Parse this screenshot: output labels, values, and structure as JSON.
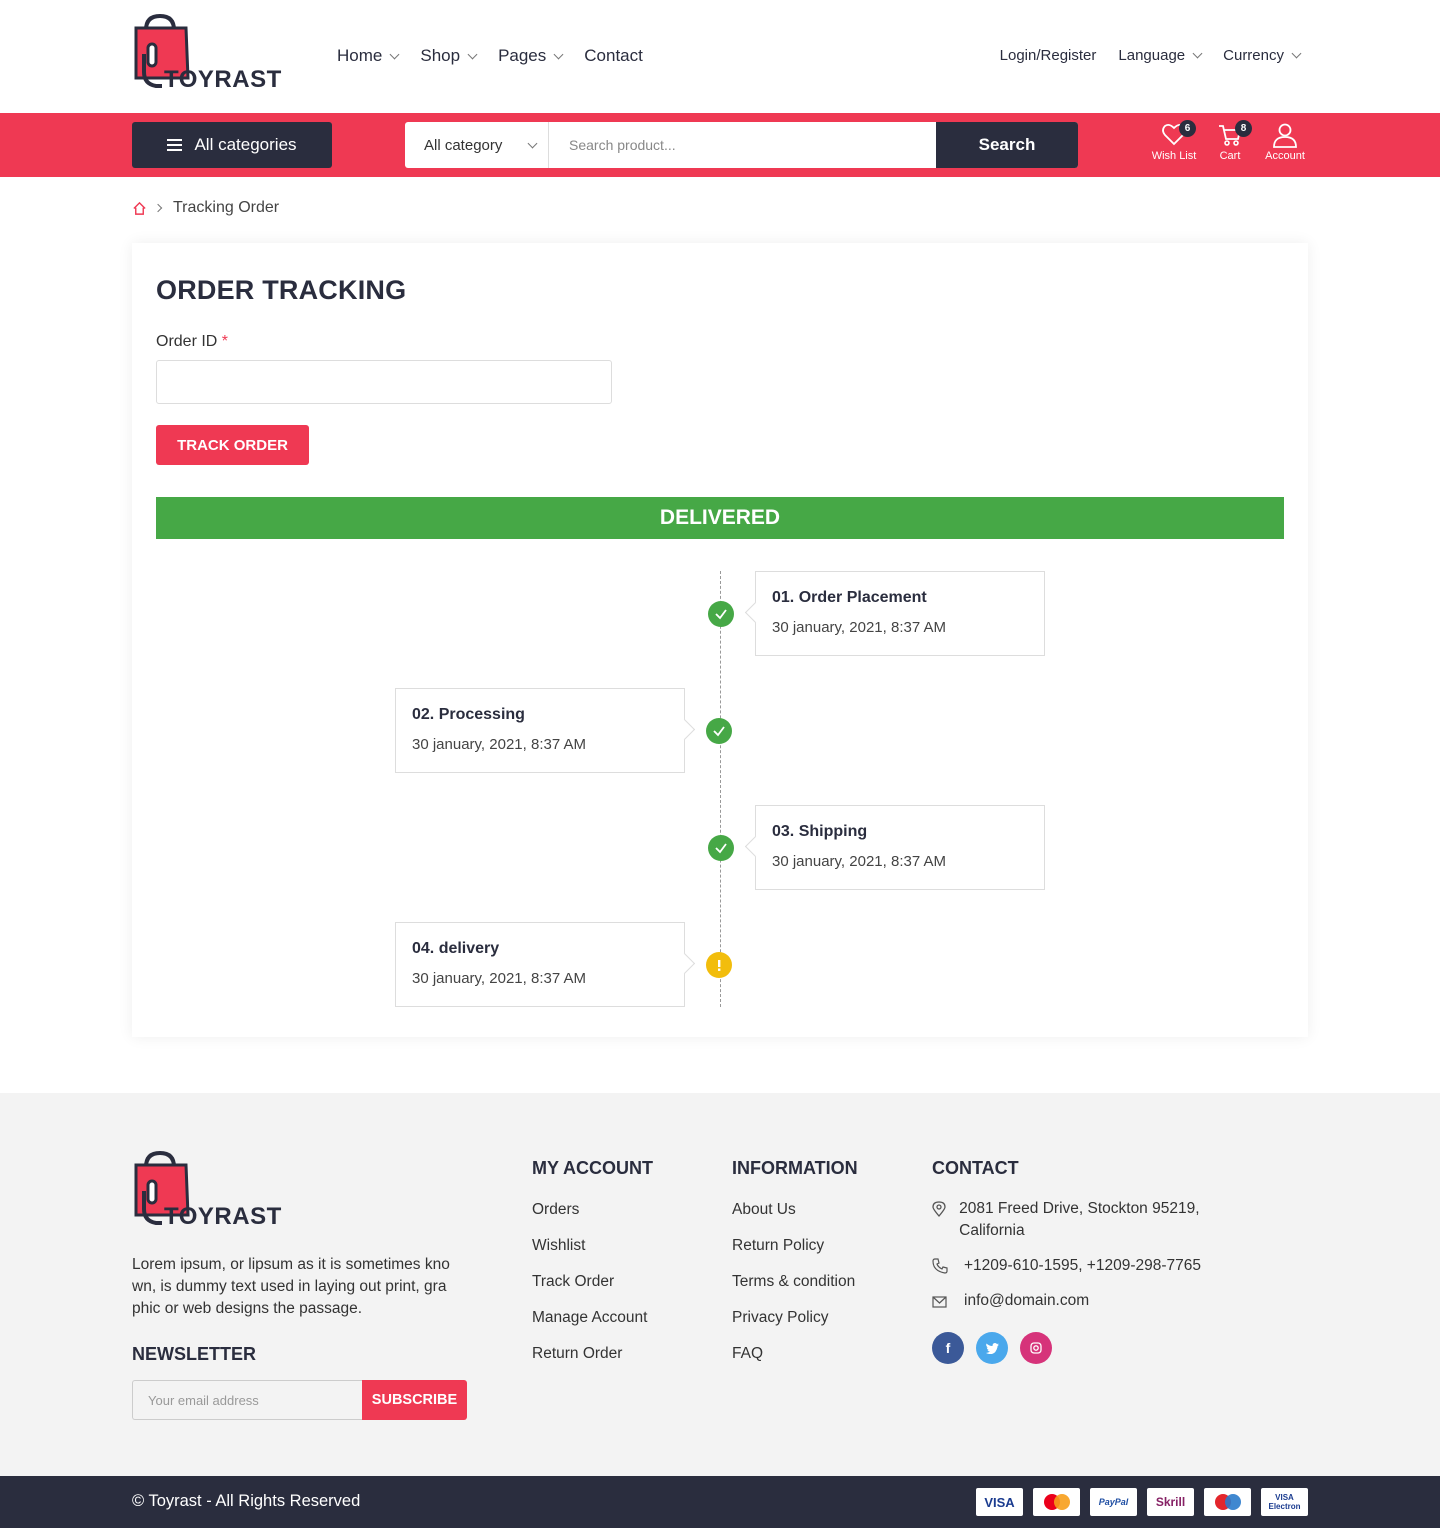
{
  "brand": {
    "name": "TOYRAST",
    "accent": "#ef3953",
    "dark": "#2a2d3e"
  },
  "nav": {
    "items": [
      "Home",
      "Shop",
      "Pages",
      "Contact"
    ],
    "login": "Login/Register",
    "language": "Language",
    "currency": "Currency"
  },
  "searchbar": {
    "all_categories": "All categories",
    "category_select": "All category",
    "placeholder": "Search product...",
    "search_label": "Search"
  },
  "header_icons": {
    "wishlist": {
      "label": "Wish List",
      "count": "6",
      "icon": "heart-icon"
    },
    "cart": {
      "label": "Cart",
      "count": "8",
      "icon": "cart-icon"
    },
    "account": {
      "label": "Account",
      "icon": "user-icon"
    }
  },
  "breadcrumb": {
    "current": "Tracking Order"
  },
  "tracking": {
    "title": "ORDER TRACKING",
    "order_id_label": "Order ID",
    "required_mark": "*",
    "button": "TRACK ORDER",
    "status": "DELIVERED",
    "status_color": "#46a846",
    "steps": [
      {
        "title": "01. Order Placement",
        "date": "30 january, 2021, 8:37 AM",
        "state": "done"
      },
      {
        "title": "02. Processing",
        "date": "30 january, 2021, 8:37 AM",
        "state": "done"
      },
      {
        "title": "03. Shipping",
        "date": "30 january, 2021, 8:37 AM",
        "state": "done"
      },
      {
        "title": "04. delivery",
        "date": "30 january, 2021, 8:37 AM",
        "state": "pending"
      }
    ]
  },
  "footer": {
    "about": "Lorem ipsum, or lipsum as it is sometimes kno wn, is dummy text used in laying out print, gra phic or web designs the passage.",
    "newsletter_title": "NEWSLETTER",
    "email_placeholder": "Your email address",
    "subscribe": "SUBSCRIBE",
    "my_account": {
      "title": "MY ACCOUNT",
      "links": [
        "Orders",
        "Wishlist",
        "Track Order",
        "Manage Account",
        "Return Order"
      ]
    },
    "information": {
      "title": "INFORMATION",
      "links": [
        "About Us",
        "Return Policy",
        "Terms & condition",
        "Privacy Policy",
        "FAQ"
      ]
    },
    "contact": {
      "title": "CONTACT",
      "address": "2081 Freed Drive, Stockton 95219, California",
      "phone": "+1209-610-1595, +1209-298-7765",
      "email": "info@domain.com"
    },
    "social": [
      {
        "icon": "facebook-icon",
        "color": "#3b5998"
      },
      {
        "icon": "twitter-icon",
        "color": "#4aa8ec"
      },
      {
        "icon": "instagram-icon",
        "color": "#d6337a"
      }
    ],
    "copyright": "© Toyrast - All Rights Reserved",
    "payments": [
      "VISA",
      "MasterCard",
      "PayPal",
      "Skrill",
      "Maestro",
      "VISA Electron"
    ]
  }
}
